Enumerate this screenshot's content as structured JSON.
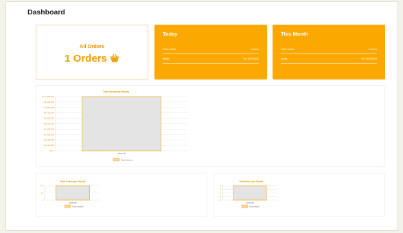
{
  "page_title": "Dashboard",
  "cards": {
    "all_orders": {
      "title": "All Orders",
      "value": "1 Orders",
      "icon": "basket-icon"
    },
    "today": {
      "title": "Today",
      "rows": [
        {
          "left": "Order details",
          "right": "1 Orders"
        },
        {
          "left": "details",
          "right": "Rs. 999,999.00"
        }
      ]
    },
    "this_month": {
      "title": "This Month",
      "rows": [
        {
          "left": "Order details",
          "right": "1 Orders"
        },
        {
          "left": "details",
          "right": "Rs. 999,999.00"
        }
      ]
    }
  },
  "colors": {
    "accent": "#fba900",
    "accent_text": "#e59100",
    "bar_fill": "#e4e4e4",
    "bar_border": "#f5b22a",
    "legend_fill": "#f3d79c"
  },
  "chart_data": [
    {
      "type": "bar",
      "title": "Total Income per Month",
      "categories": [
        "2023-08"
      ],
      "series": [
        {
          "name": "Total Income",
          "values": [
            1000000
          ]
        }
      ],
      "ylim": [
        0,
        1000000
      ],
      "yticks": [
        "Rs.1,000,000",
        "Rs.900,000",
        "Rs.800,000",
        "Rs.700,000",
        "Rs.600,000",
        "Rs.500,000",
        "Rs.400,000",
        "Rs.300,000",
        "Rs.200,000",
        "Rs.100,000",
        "Rs.0"
      ],
      "grid": true,
      "legend": "bottom"
    },
    {
      "type": "bar",
      "title": "Total Orders per Month",
      "categories": [
        "2023-08"
      ],
      "series": [
        {
          "name": "Total Orders",
          "values": [
            1
          ]
        }
      ],
      "ylim": [
        0,
        1
      ],
      "yticks": [
        "1.0",
        "0.5",
        "0"
      ],
      "grid": true,
      "legend": "bottom"
    },
    {
      "type": "bar",
      "title": "Total Items per Month",
      "categories": [
        "2023-08"
      ],
      "series": [
        {
          "name": "Total Items",
          "values": [
            4
          ]
        }
      ],
      "ylim": [
        0,
        4
      ],
      "yticks": [
        "4",
        "3",
        "2",
        "1",
        "0"
      ],
      "grid": true,
      "legend": "bottom"
    }
  ]
}
